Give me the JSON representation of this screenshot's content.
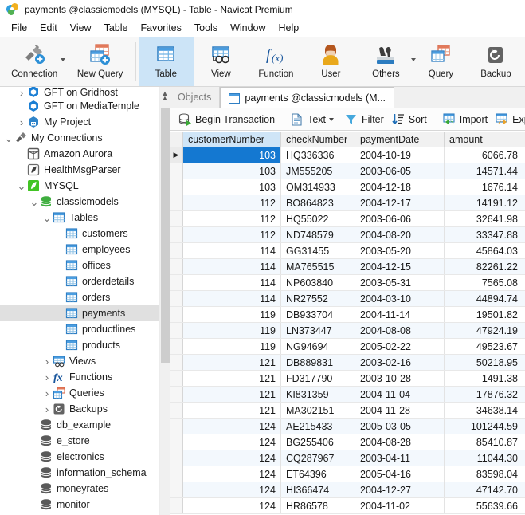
{
  "window": {
    "title": "payments @classicmodels (MYSQL) - Table - Navicat Premium",
    "logo_icon": "navicat-logo"
  },
  "menubar": {
    "items": [
      {
        "label": "File"
      },
      {
        "label": "Edit"
      },
      {
        "label": "View"
      },
      {
        "label": "Table"
      },
      {
        "label": "Favorites"
      },
      {
        "label": "Tools"
      },
      {
        "label": "Window"
      },
      {
        "label": "Help"
      }
    ]
  },
  "ribbon": {
    "items": [
      {
        "label": "Connection",
        "icon": "connection-plug-icon",
        "has_caret": true,
        "active": false
      },
      {
        "label": "New Query",
        "icon": "new-query-icon",
        "has_caret": false,
        "active": false
      },
      {
        "label": "Table",
        "icon": "table-grid-icon",
        "has_caret": false,
        "active": true
      },
      {
        "label": "View",
        "icon": "view-glasses-icon",
        "has_caret": false,
        "active": false
      },
      {
        "label": "Function",
        "icon": "function-fx-icon",
        "has_caret": false,
        "active": false
      },
      {
        "label": "User",
        "icon": "user-person-icon",
        "has_caret": false,
        "active": false
      },
      {
        "label": "Others",
        "icon": "others-tools-icon",
        "has_caret": true,
        "active": false
      },
      {
        "label": "Query",
        "icon": "query-calendar-grid-icon",
        "has_caret": false,
        "active": false
      },
      {
        "label": "Backup",
        "icon": "backup-restore-icon",
        "has_caret": false,
        "active": false
      }
    ]
  },
  "sidebar": {
    "scroll_up_icon": "chevron-up-icon",
    "items": [
      {
        "label": "GFT on Gridhost",
        "icon": "hex-blue-icon",
        "indent": 1,
        "twisty": "collapsed",
        "partial": true,
        "selected": false
      },
      {
        "label": "GFT on MediaTemple",
        "icon": "hex-blue-icon",
        "indent": 1,
        "twisty": "none",
        "selected": false
      },
      {
        "label": "My Project",
        "icon": "project-hex-icon",
        "indent": 1,
        "twisty": "collapsed",
        "selected": false
      },
      {
        "label": "My Connections",
        "icon": "connection-plug-icon",
        "indent": 0,
        "twisty": "expanded",
        "selected": false
      },
      {
        "label": "Amazon Aurora",
        "icon": "aurora-box-icon",
        "indent": 1,
        "twisty": "none",
        "selected": false
      },
      {
        "label": "HealthMsgParser",
        "icon": "mysql-leaf-gray-icon",
        "indent": 1,
        "twisty": "none",
        "selected": false
      },
      {
        "label": "MYSQL",
        "icon": "mysql-leaf-green-icon",
        "indent": 1,
        "twisty": "expanded",
        "selected": false
      },
      {
        "label": "classicmodels",
        "icon": "database-green-icon",
        "indent": 2,
        "twisty": "expanded",
        "selected": false
      },
      {
        "label": "Tables",
        "icon": "tables-folder-icon",
        "indent": 3,
        "twisty": "expanded",
        "selected": false
      },
      {
        "label": "customers",
        "icon": "table-icon",
        "indent": 4,
        "twisty": "none",
        "selected": false
      },
      {
        "label": "employees",
        "icon": "table-icon",
        "indent": 4,
        "twisty": "none",
        "selected": false
      },
      {
        "label": "offices",
        "icon": "table-icon",
        "indent": 4,
        "twisty": "none",
        "selected": false
      },
      {
        "label": "orderdetails",
        "icon": "table-icon",
        "indent": 4,
        "twisty": "none",
        "selected": false
      },
      {
        "label": "orders",
        "icon": "table-icon",
        "indent": 4,
        "twisty": "none",
        "selected": false
      },
      {
        "label": "payments",
        "icon": "table-icon",
        "indent": 4,
        "twisty": "none",
        "selected": true
      },
      {
        "label": "productlines",
        "icon": "table-icon",
        "indent": 4,
        "twisty": "none",
        "selected": false
      },
      {
        "label": "products",
        "icon": "table-icon",
        "indent": 4,
        "twisty": "none",
        "selected": false
      },
      {
        "label": "Views",
        "icon": "views-icon",
        "indent": 3,
        "twisty": "collapsed",
        "selected": false
      },
      {
        "label": "Functions",
        "icon": "function-fx-icon",
        "indent": 3,
        "twisty": "collapsed",
        "selected": false
      },
      {
        "label": "Queries",
        "icon": "queries-icon",
        "indent": 3,
        "twisty": "collapsed",
        "selected": false
      },
      {
        "label": "Backups",
        "icon": "backup-restore-icon",
        "indent": 3,
        "twisty": "collapsed",
        "selected": false
      },
      {
        "label": "db_example",
        "icon": "database-gray-icon",
        "indent": 2,
        "twisty": "none",
        "selected": false
      },
      {
        "label": "e_store",
        "icon": "database-gray-icon",
        "indent": 2,
        "twisty": "none",
        "selected": false
      },
      {
        "label": "electronics",
        "icon": "database-gray-icon",
        "indent": 2,
        "twisty": "none",
        "selected": false
      },
      {
        "label": "information_schema",
        "icon": "database-gray-icon",
        "indent": 2,
        "twisty": "none",
        "selected": false
      },
      {
        "label": "moneyrates",
        "icon": "database-gray-icon",
        "indent": 2,
        "twisty": "none",
        "selected": false
      },
      {
        "label": "monitor",
        "icon": "database-gray-icon",
        "indent": 2,
        "twisty": "none",
        "selected": false
      }
    ]
  },
  "main": {
    "tabs": [
      {
        "label": "Objects",
        "active": false,
        "has_icon": false
      },
      {
        "label": "payments @classicmodels (M...",
        "active": true,
        "has_icon": true
      }
    ],
    "toolbar": [
      {
        "label": "Begin Transaction",
        "icon": "begin-transaction-icon",
        "caret": false,
        "sep_after": true
      },
      {
        "label": "Text",
        "icon": "text-document-icon",
        "caret": true,
        "sep_after": false
      },
      {
        "label": "Filter",
        "icon": "filter-funnel-icon",
        "caret": false,
        "sep_after": false
      },
      {
        "label": "Sort",
        "icon": "sort-icon",
        "caret": false,
        "sep_after": true
      },
      {
        "label": "Import",
        "icon": "import-icon",
        "caret": false,
        "sep_after": false
      },
      {
        "label": "Export",
        "icon": "export-icon",
        "caret": false,
        "sep_after": false
      }
    ],
    "grid": {
      "columns": [
        "customerNumber",
        "checkNumber",
        "paymentDate",
        "amount"
      ],
      "selected_column": "customerNumber",
      "selected_cell": {
        "row": 0,
        "column": "customerNumber"
      },
      "selection_color": "#1478d1",
      "rows": [
        {
          "customerNumber": "103",
          "checkNumber": "HQ336336",
          "paymentDate": "2004-10-19",
          "amount": "6066.78"
        },
        {
          "customerNumber": "103",
          "checkNumber": "JM555205",
          "paymentDate": "2003-06-05",
          "amount": "14571.44"
        },
        {
          "customerNumber": "103",
          "checkNumber": "OM314933",
          "paymentDate": "2004-12-18",
          "amount": "1676.14"
        },
        {
          "customerNumber": "112",
          "checkNumber": "BO864823",
          "paymentDate": "2004-12-17",
          "amount": "14191.12"
        },
        {
          "customerNumber": "112",
          "checkNumber": "HQ55022",
          "paymentDate": "2003-06-06",
          "amount": "32641.98"
        },
        {
          "customerNumber": "112",
          "checkNumber": "ND748579",
          "paymentDate": "2004-08-20",
          "amount": "33347.88"
        },
        {
          "customerNumber": "114",
          "checkNumber": "GG31455",
          "paymentDate": "2003-05-20",
          "amount": "45864.03"
        },
        {
          "customerNumber": "114",
          "checkNumber": "MA765515",
          "paymentDate": "2004-12-15",
          "amount": "82261.22"
        },
        {
          "customerNumber": "114",
          "checkNumber": "NP603840",
          "paymentDate": "2003-05-31",
          "amount": "7565.08"
        },
        {
          "customerNumber": "114",
          "checkNumber": "NR27552",
          "paymentDate": "2004-03-10",
          "amount": "44894.74"
        },
        {
          "customerNumber": "119",
          "checkNumber": "DB933704",
          "paymentDate": "2004-11-14",
          "amount": "19501.82"
        },
        {
          "customerNumber": "119",
          "checkNumber": "LN373447",
          "paymentDate": "2004-08-08",
          "amount": "47924.19"
        },
        {
          "customerNumber": "119",
          "checkNumber": "NG94694",
          "paymentDate": "2005-02-22",
          "amount": "49523.67"
        },
        {
          "customerNumber": "121",
          "checkNumber": "DB889831",
          "paymentDate": "2003-02-16",
          "amount": "50218.95"
        },
        {
          "customerNumber": "121",
          "checkNumber": "FD317790",
          "paymentDate": "2003-10-28",
          "amount": "1491.38"
        },
        {
          "customerNumber": "121",
          "checkNumber": "KI831359",
          "paymentDate": "2004-11-04",
          "amount": "17876.32"
        },
        {
          "customerNumber": "121",
          "checkNumber": "MA302151",
          "paymentDate": "2004-11-28",
          "amount": "34638.14"
        },
        {
          "customerNumber": "124",
          "checkNumber": "AE215433",
          "paymentDate": "2005-03-05",
          "amount": "101244.59"
        },
        {
          "customerNumber": "124",
          "checkNumber": "BG255406",
          "paymentDate": "2004-08-28",
          "amount": "85410.87"
        },
        {
          "customerNumber": "124",
          "checkNumber": "CQ287967",
          "paymentDate": "2003-04-11",
          "amount": "11044.30"
        },
        {
          "customerNumber": "124",
          "checkNumber": "ET64396",
          "paymentDate": "2005-04-16",
          "amount": "83598.04"
        },
        {
          "customerNumber": "124",
          "checkNumber": "HI366474",
          "paymentDate": "2004-12-27",
          "amount": "47142.70"
        },
        {
          "customerNumber": "124",
          "checkNumber": "HR86578",
          "paymentDate": "2004-11-02",
          "amount": "55639.66"
        }
      ]
    }
  }
}
